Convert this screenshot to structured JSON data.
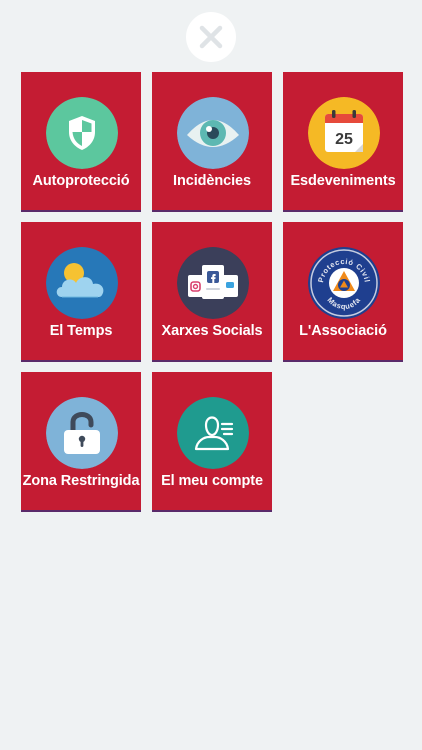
{
  "close": {
    "icon": "close-icon"
  },
  "menu": {
    "items": [
      {
        "label": "Autoprotecció",
        "icon": "shield-icon",
        "circle_color": "#5cc79e"
      },
      {
        "label": "Incidències",
        "icon": "eye-icon",
        "circle_color": "#7fb3d8"
      },
      {
        "label": "Esdeveniments",
        "icon": "calendar-icon",
        "circle_color": "#f5b925",
        "calendar_day": "25"
      },
      {
        "label": "El Temps",
        "icon": "weather-icon",
        "circle_color": "#2778b8"
      },
      {
        "label": "Xarxes Socials",
        "icon": "social-networks-icon",
        "circle_color": "#3b3f5a"
      },
      {
        "label": "L'Associació",
        "icon": "association-logo",
        "circle_color": "#1f3f8f",
        "logo_text": "Protecció Civil Masquefa"
      },
      {
        "label": "Zona Restringida",
        "icon": "padlock-icon",
        "circle_color": "#7fb3d8"
      },
      {
        "label": "El meu compte",
        "icon": "user-account-icon",
        "circle_color": "#1f9b8f"
      }
    ]
  },
  "colors": {
    "background": "#eff2f3",
    "tile": "#c41c33",
    "tile_label": "#ffffff"
  }
}
